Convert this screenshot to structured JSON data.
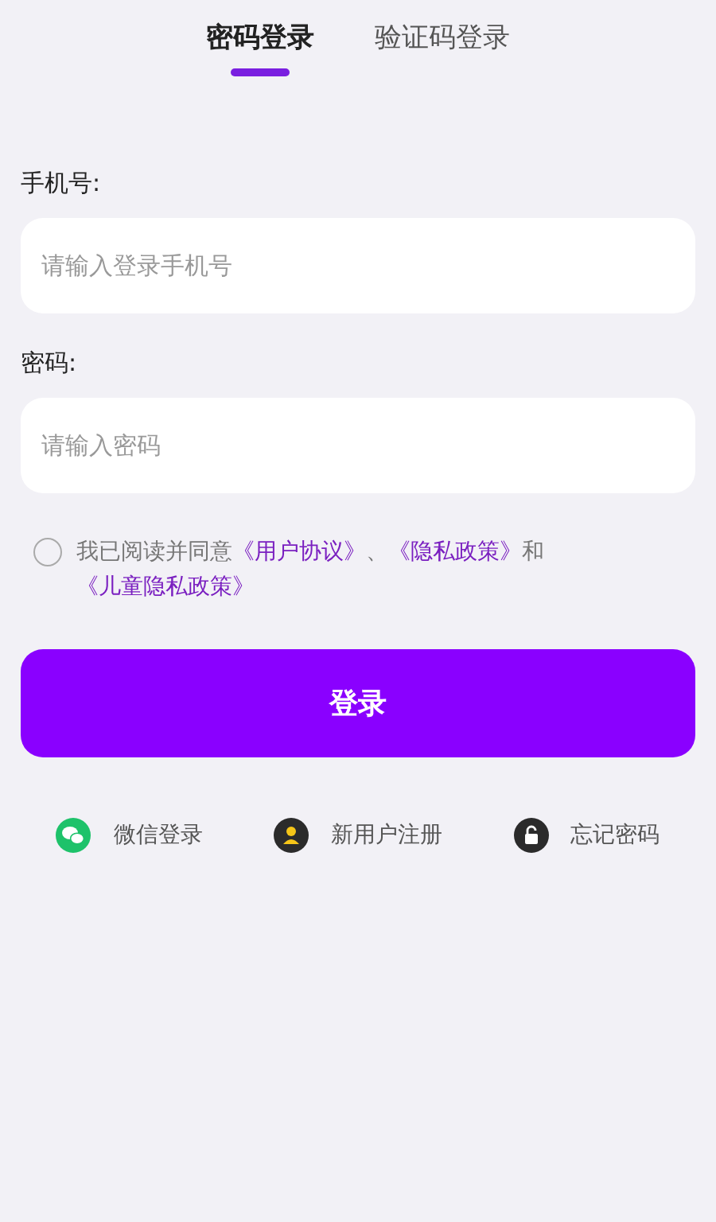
{
  "tabs": [
    {
      "label": "密码登录",
      "selected": true
    },
    {
      "label": "验证码登录",
      "selected": false
    }
  ],
  "fields": [
    {
      "label": "手机号:",
      "placeholder": "请输入登录手机号"
    },
    {
      "label": "密码:",
      "placeholder": "请输入密码"
    }
  ],
  "agreement": {
    "checked": false,
    "parts": [
      {
        "kind": "text",
        "text": "我已阅读并同意"
      },
      {
        "kind": "link",
        "text": "《用户协议》"
      },
      {
        "kind": "text",
        "text": "、"
      },
      {
        "kind": "link",
        "text": "《隐私政策》"
      },
      {
        "kind": "text",
        "text": "和"
      },
      {
        "kind": "link",
        "text": "《儿童隐私政策》"
      }
    ]
  },
  "login_button": "登录",
  "shortcuts": [
    {
      "kind": "wechat",
      "label": "微信登录"
    },
    {
      "kind": "register",
      "label": "新用户注册"
    },
    {
      "kind": "forgot",
      "label": "忘记密码"
    }
  ]
}
